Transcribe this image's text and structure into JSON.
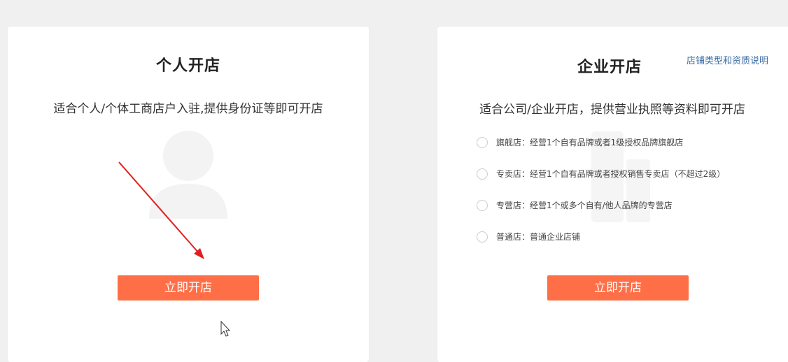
{
  "personal": {
    "title": "个人开店",
    "description": "适合个人/个体工商店户入驻,提供身份证等即可开店",
    "button_label": "立即开店"
  },
  "enterprise": {
    "title": "企业开店",
    "help_link": "店铺类型和资质说明",
    "description": "适合公司/企业开店，提供营业执照等资料即可开店",
    "options": [
      {
        "label": "旗舰店：经营1个自有品牌或者1级授权品牌旗舰店"
      },
      {
        "label": "专卖店：经营1个自有品牌或者授权销售专卖店（不超过2级）"
      },
      {
        "label": "专营店：经营1个或多个自有/他人品牌的专营店"
      },
      {
        "label": "普通店：普通企业店铺"
      }
    ],
    "button_label": "立即开店"
  },
  "colors": {
    "page_background": "#f0f0f0",
    "card_background": "#ffffff",
    "button": "#ff6f47",
    "link": "#3a6ea5",
    "annotation_arrow": "#e02020"
  },
  "icons": {
    "personal_watermark": "person-silhouette-icon",
    "enterprise_watermark": "building-icon",
    "cursor": "mouse-pointer-icon"
  }
}
